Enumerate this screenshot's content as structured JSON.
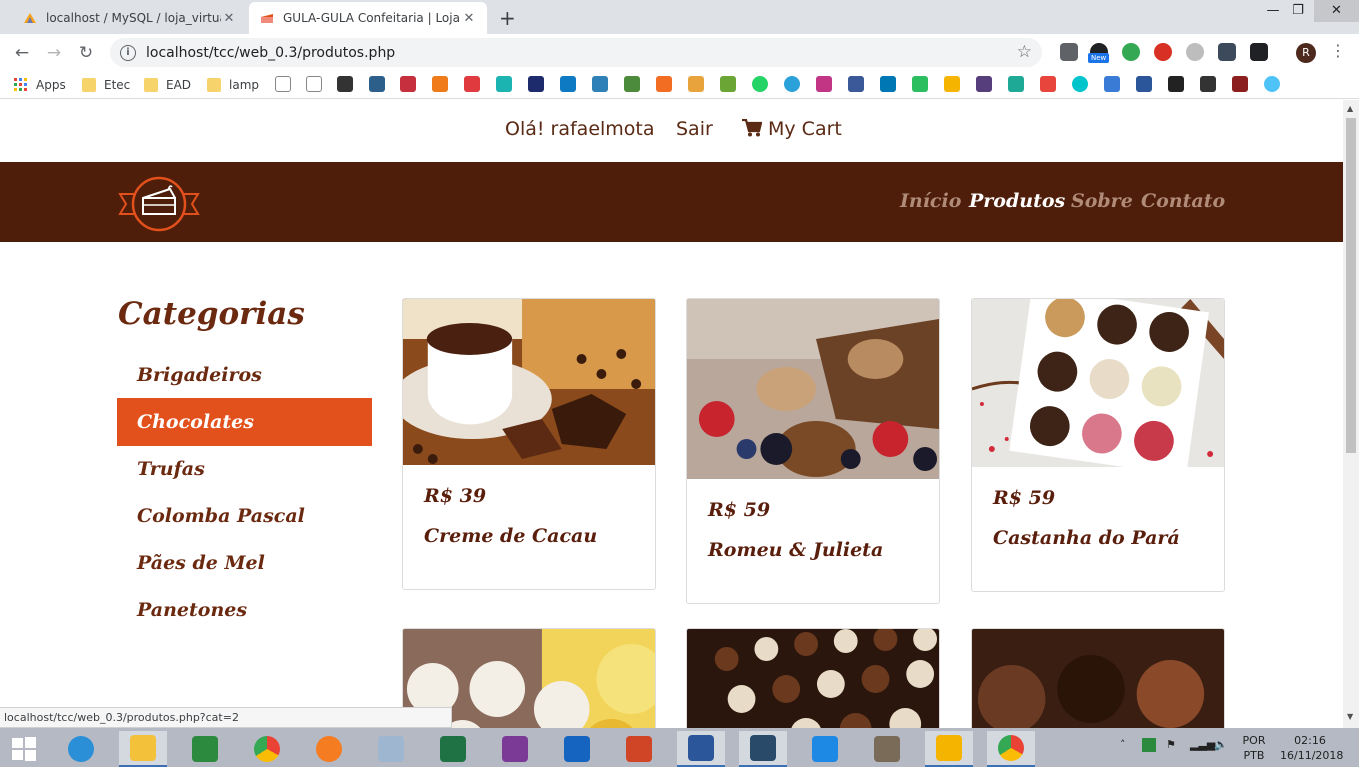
{
  "browser": {
    "tabs": [
      {
        "title": "localhost / MySQL / loja_virtual /",
        "active": false
      },
      {
        "title": "GULA-GULA Confeitaria | Loja vir",
        "active": true
      }
    ],
    "url": "localhost/tcc/web_0.3/produtos.php",
    "status_url": "localhost/tcc/web_0.3/produtos.php?cat=2",
    "ext_badge": "New",
    "profile_initial": "R",
    "bookmarks": [
      {
        "label": "Apps",
        "icon": "apps-grid-icon"
      },
      {
        "label": "Etec",
        "icon": "folder-icon"
      },
      {
        "label": "EAD",
        "icon": "folder-icon"
      },
      {
        "label": "lamp",
        "icon": "folder-icon"
      }
    ]
  },
  "site": {
    "greeting": "Olá! rafaelmota",
    "logout": "Sair",
    "cart": "My Cart",
    "nav": [
      "Início",
      "Produtos",
      "Sobre",
      "Contato"
    ],
    "nav_active": "Produtos",
    "categories_title": "Categorias",
    "categories": [
      "Brigadeiros",
      "Chocolates",
      "Trufas",
      "Colomba Pascal",
      "Pães de Mel",
      "Panetones"
    ],
    "selected_category": "Chocolates",
    "products": [
      {
        "price": "R$ 39",
        "name": "Creme de Cacau"
      },
      {
        "price": "R$ 59",
        "name": "Romeu & Julieta"
      },
      {
        "price": "R$ 59",
        "name": "Castanha do Pará"
      }
    ],
    "colors": {
      "header": "#4e1e0b",
      "accent": "#e2501b",
      "text": "#6b2a10"
    }
  },
  "taskbar": {
    "lang_line1": "POR",
    "lang_line2": "PTB",
    "time": "02:16",
    "date": "16/11/2018"
  }
}
